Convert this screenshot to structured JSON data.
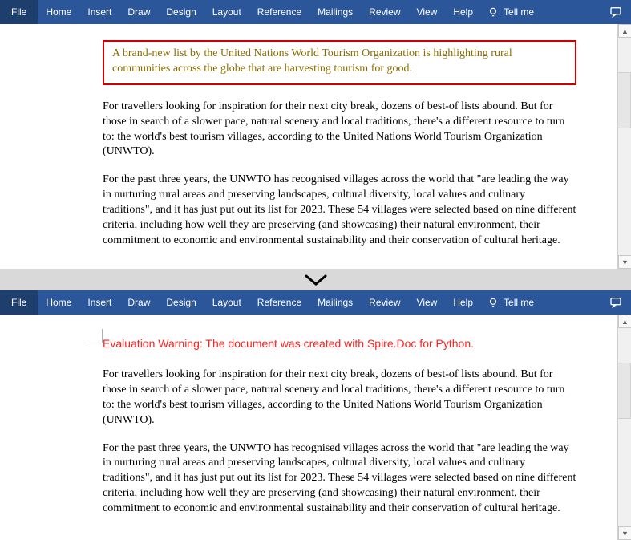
{
  "ribbon": {
    "file": "File",
    "tabs": [
      "Home",
      "Insert",
      "Draw",
      "Design",
      "Layout",
      "Reference",
      "Mailings",
      "Review",
      "View",
      "Help"
    ],
    "tellme": "Tell me"
  },
  "top_doc": {
    "highlight": "A brand-new list by the United Nations World Tourism Organization is highlighting rural communities across the globe that are harvesting tourism for good.",
    "para1": "For travellers looking for inspiration for their next city break, dozens of best-of lists abound. But for those in search of a slower pace, natural scenery and local traditions, there's a different resource to turn to: the world's best tourism villages, according to the United Nations World Tourism Organization (UNWTO).",
    "para2": "For the past three years, the UNWTO has recognised villages across the world that \"are leading the way in nurturing rural areas and preserving landscapes, cultural diversity, local values and culinary traditions\", and it has just put out its list for 2023. These 54 villages were selected based on nine different criteria, including how well they are preserving (and showcasing) their natural environment, their commitment to economic and environmental sustainability and their conservation of cultural heritage."
  },
  "bottom_doc": {
    "warning": "Evaluation Warning: The document was created with Spire.Doc for Python.",
    "para1": "For travellers looking for inspiration for their next city break, dozens of best-of lists abound. But for those in search of a slower pace, natural scenery and local traditions, there's a different resource to turn to: the world's best tourism villages, according to the United Nations World Tourism Organization (UNWTO).",
    "para2": "For the past three years, the UNWTO has recognised villages across the world that \"are leading the way in nurturing rural areas and preserving landscapes, cultural diversity, local values and culinary traditions\", and it has just put out its list for 2023. These 54 villages were selected based on nine different criteria, including how well they are preserving (and showcasing) their natural environment, their commitment to economic and environmental sustainability and their conservation of cultural heritage."
  }
}
